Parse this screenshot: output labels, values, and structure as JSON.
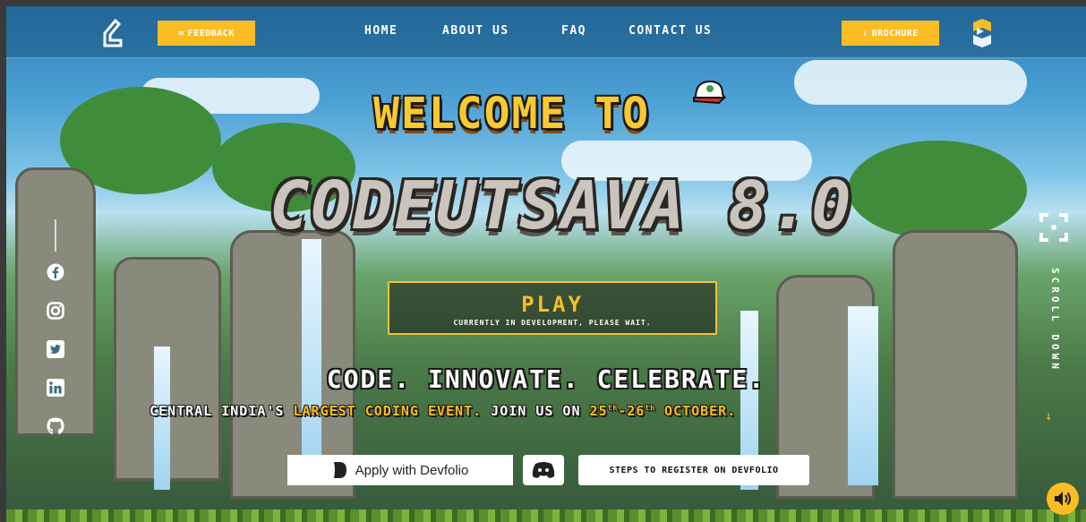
{
  "header": {
    "feedback_label": "FEEDBACK",
    "brochure_label": "BROCHURE",
    "nav": [
      "HOME",
      "ABOUT US",
      "FAQ",
      "CONTACT US"
    ]
  },
  "hero": {
    "welcome": "WELCOME TO",
    "title": "CODEUTSAVA 8.0",
    "play_title": "PLAY",
    "play_subtitle": "CURRENTLY IN DEVELOPMENT, PLEASE WAIT.",
    "tagline": "CODE. INNOVATE. CELEBRATE.",
    "subline_prefix": "CENTRAL INDIA'S ",
    "subline_highlight": "LARGEST CODING EVENT.",
    "subline_mid": " JOIN US ON ",
    "date_start": "25",
    "date_start_suffix": "th",
    "date_sep": "-",
    "date_end": "26",
    "date_end_suffix": "th",
    "date_month": " OCTOBER."
  },
  "actions": {
    "devfolio_label": "Apply with Devfolio",
    "steps_label": "STEPS TO REGISTER ON DEVFOLIO"
  },
  "side": {
    "scroll_label": "SCROLL DOWN"
  },
  "icons": [
    "facebook-icon",
    "instagram-icon",
    "twitter-icon",
    "linkedin-icon",
    "github-icon",
    "discord-icon",
    "sound-icon",
    "focus-icon"
  ],
  "colors": {
    "accent": "#fbbd23",
    "title_stone": "#c9c4bd"
  }
}
